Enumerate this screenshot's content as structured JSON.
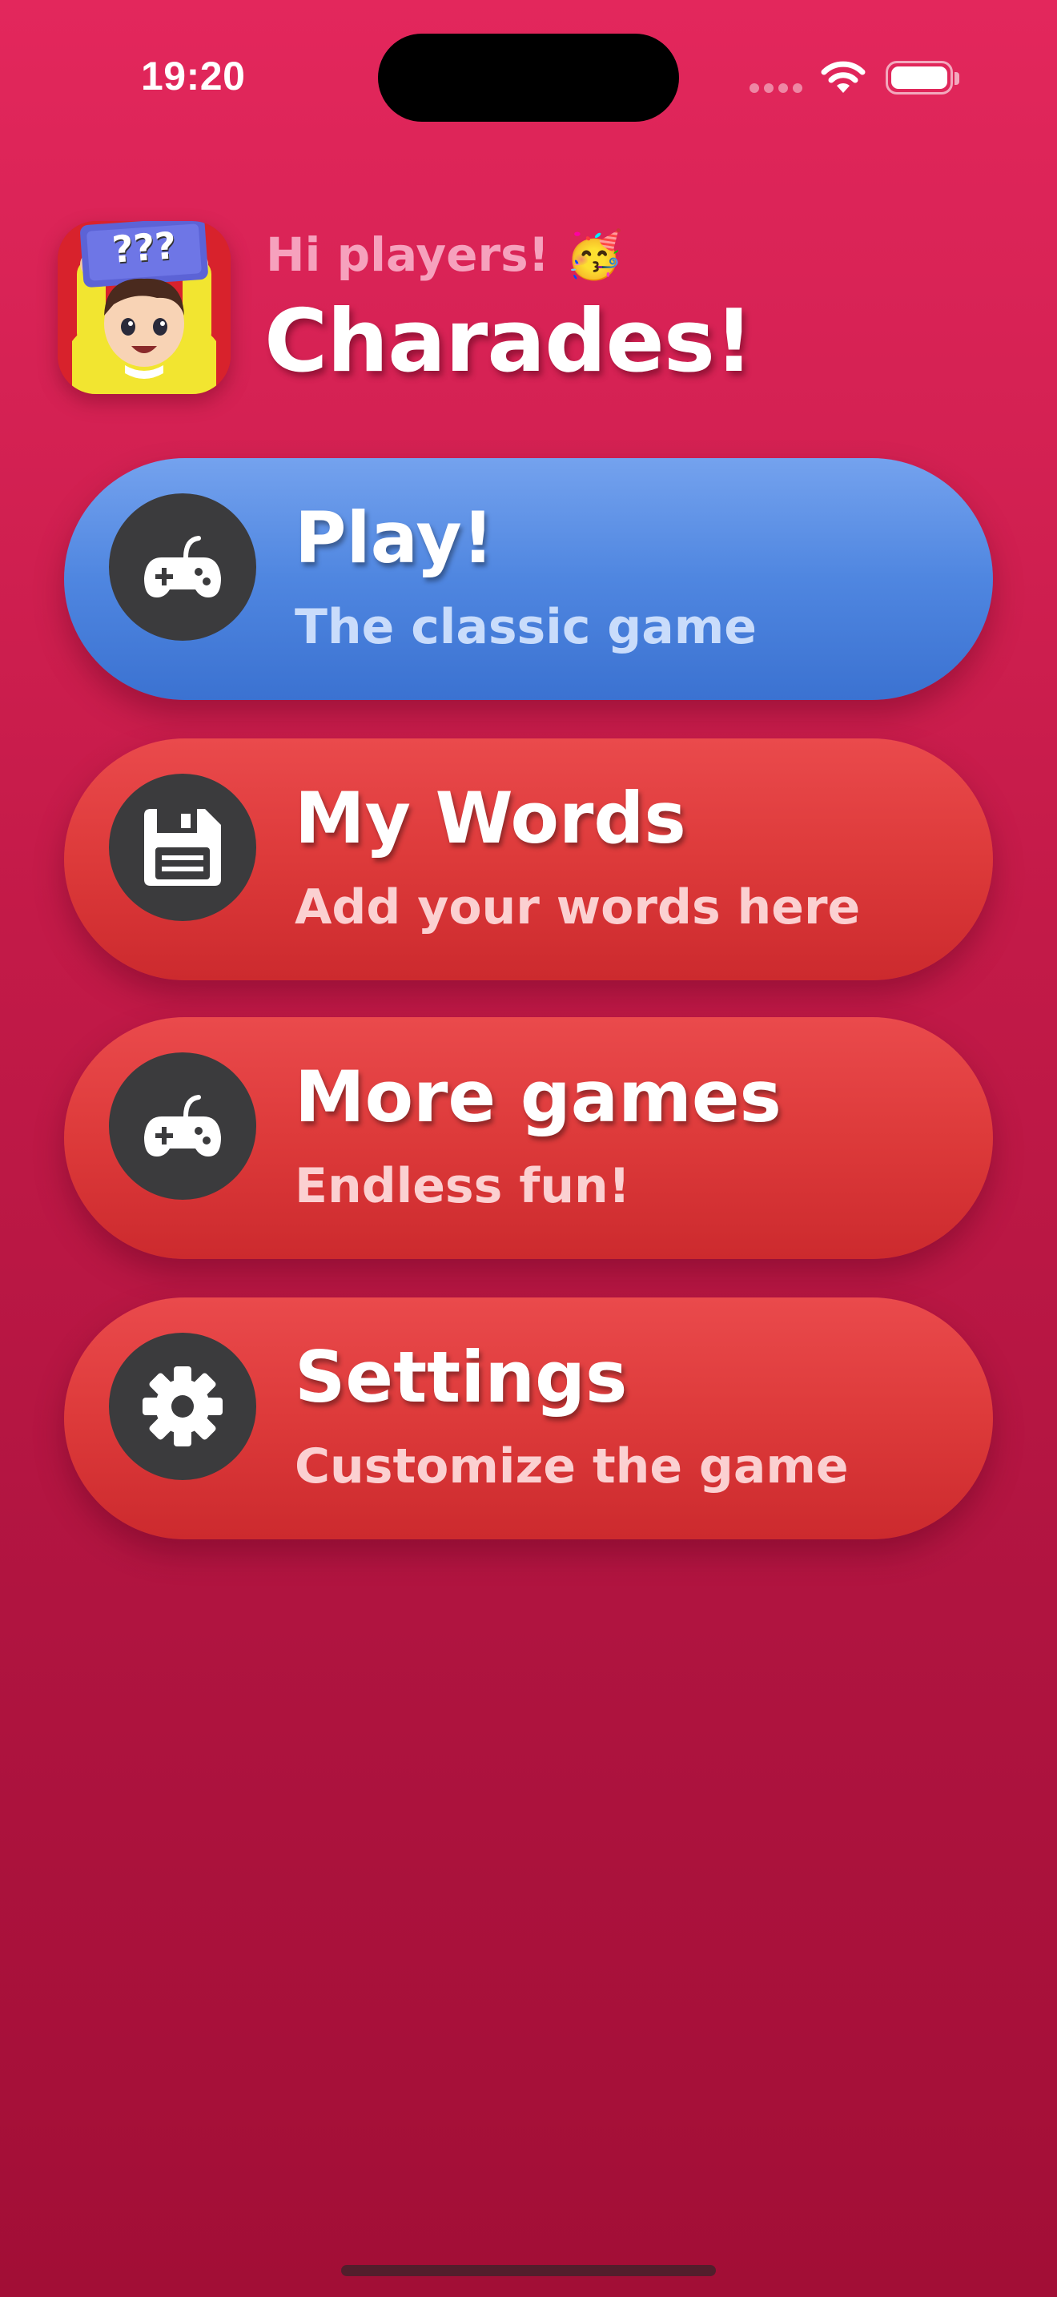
{
  "status_bar": {
    "time": "19:20"
  },
  "header": {
    "greeting": "Hi players! 🥳",
    "title": "Charades!",
    "app_icon": {
      "icon": "charades-kid-logo",
      "badge_text": "???"
    }
  },
  "menu": {
    "items": [
      {
        "title": "Play!",
        "subtitle": "The classic game",
        "icon": "gamepad-icon",
        "color": "#4f86e0"
      },
      {
        "title": "My Words",
        "subtitle": "Add your words here",
        "icon": "floppy-disk-icon",
        "color": "#dd3a3a"
      },
      {
        "title": "More games",
        "subtitle": "Endless fun!",
        "icon": "gamepad-icon",
        "color": "#dd3a3a"
      },
      {
        "title": "Settings",
        "subtitle": "Customize the game",
        "icon": "gear-icon",
        "color": "#dd3a3a"
      }
    ]
  },
  "colors": {
    "background_top": "#e3275c",
    "background_bottom": "#a20e36",
    "icon_circle": "#3b3b3d"
  }
}
